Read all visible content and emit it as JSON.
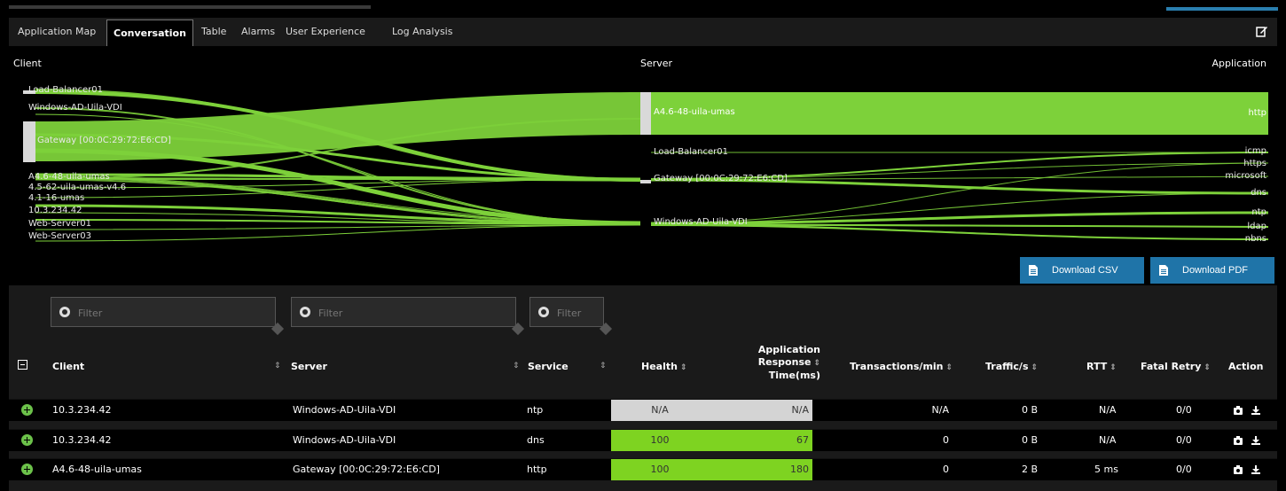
{
  "tabs": [
    {
      "label": "Application Map",
      "active": false
    },
    {
      "label": "Conversation",
      "active": true
    },
    {
      "label": "Table",
      "active": false
    },
    {
      "label": "Alarms",
      "active": false
    },
    {
      "label": "User Experience",
      "active": false
    },
    {
      "label": "Log Analysis",
      "active": false
    }
  ],
  "icons": {
    "edit": "edit-icon",
    "download": "file-icon",
    "filter": "filter-icon",
    "expand": "expand-plus-icon",
    "collapse": "collapse-minus-icon",
    "camera": "camera-icon",
    "save": "download-icon"
  },
  "sankey": {
    "headers": {
      "client": "Client",
      "server": "Server",
      "application": "Application"
    },
    "clients": [
      "Load-Balancer01",
      "Windows-AD-Uila-VDI",
      "Gateway [00:0C:29:72:E6:CD]",
      "A4.6-48-uila-umas",
      "4.5-62-uila-umas-v4.6",
      "4.1-16-umas",
      "10.3.234.42",
      "Web-Server01",
      "Web-Server03"
    ],
    "servers": [
      "A4.6-48-uila-umas",
      "Load-Balancer01",
      "Gateway [00:0C:29:72:E6:CD]",
      "Windows-AD-Uila-VDI"
    ],
    "applications": [
      "http",
      "icmp",
      "https",
      "microsoft",
      "dns",
      "ntp",
      "ldap",
      "nbns"
    ],
    "colors": {
      "flow": "#7dd13a",
      "node": "#d9d9d9",
      "background": "#000000"
    }
  },
  "buttons": {
    "download_csv": "Download CSV",
    "download_pdf": "Download PDF"
  },
  "filters": [
    {
      "placeholder": "Filter"
    },
    {
      "placeholder": "Filter"
    },
    {
      "placeholder": "Filter"
    }
  ],
  "table": {
    "headers": {
      "client": "Client",
      "server": "Server",
      "service": "Service",
      "health": "Health",
      "art_1": "Application",
      "art_2": "Response",
      "art_3": "Time(ms)",
      "transactions": "Transactions/min",
      "traffic": "Traffic/s",
      "rtt": "RTT",
      "fatal_retry": "Fatal Retry",
      "action": "Action"
    },
    "rows": [
      {
        "client": "10.3.234.42",
        "server": "Windows-AD-Uila-VDI",
        "service": "ntp",
        "health": "N/A",
        "art": "N/A",
        "transactions": "N/A",
        "traffic": "0 B",
        "rtt": "N/A",
        "fatal_retry": "0/0",
        "health_status": "na"
      },
      {
        "client": "10.3.234.42",
        "server": "Windows-AD-Uila-VDI",
        "service": "dns",
        "health": "100",
        "art": "67",
        "transactions": "0",
        "traffic": "0 B",
        "rtt": "N/A",
        "fatal_retry": "0/0",
        "health_status": "good"
      },
      {
        "client": "A4.6-48-uila-umas",
        "server": "Gateway [00:0C:29:72:E6:CD]",
        "service": "http",
        "health": "100",
        "art": "180",
        "transactions": "0",
        "traffic": "2 B",
        "rtt": "5 ms",
        "fatal_retry": "0/0",
        "health_status": "good"
      }
    ],
    "status_colors": {
      "good": "#7ed321",
      "na": "#d4d4d4"
    }
  }
}
